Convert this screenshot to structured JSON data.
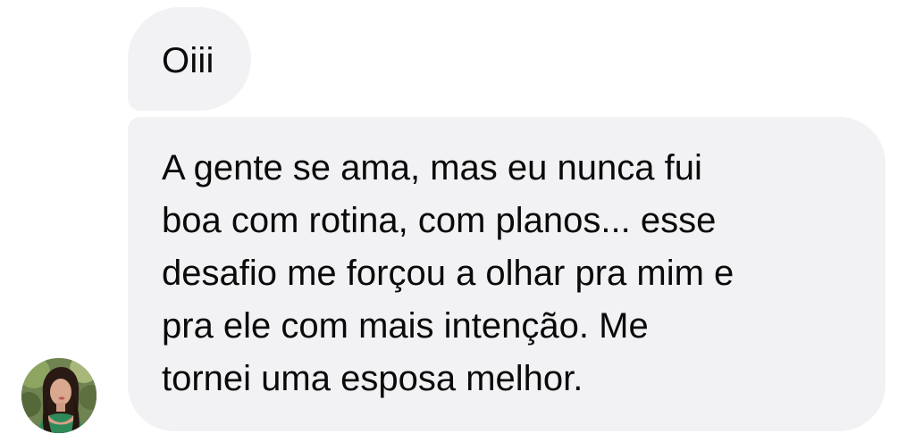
{
  "messages": [
    {
      "text": "Oiii"
    },
    {
      "text": "A gente se ama, mas eu nunca fui\nboa com rotina, com planos... esse\ndesafio me forçou a olhar pra mim e\npra ele com mais intenção. Me\ntornei uma esposa melhor."
    }
  ],
  "avatar": {
    "icon": "profile-photo"
  },
  "colors": {
    "bubble_background": "#f2f2f4",
    "text": "#0a0a0a",
    "page_background": "#ffffff"
  }
}
